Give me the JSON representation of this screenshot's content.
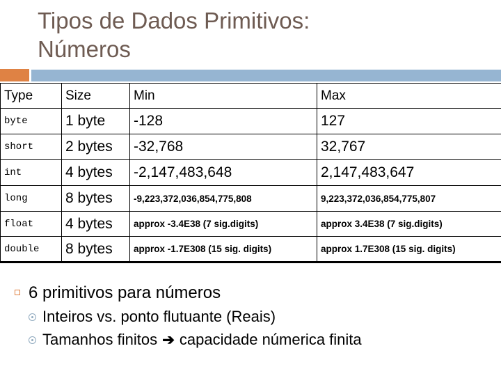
{
  "slide": {
    "title": "Tipos de Dados Primitivos:\nNúmeros",
    "title_color": "#6E5B52",
    "accent_orange": "#DF8244",
    "accent_blue": "#96B5D2"
  },
  "table": {
    "headers": [
      "Type",
      "Size",
      "Min",
      "Max"
    ],
    "rows": [
      {
        "type": "byte",
        "size": "1 byte",
        "min": "-128",
        "max": "127",
        "small": false
      },
      {
        "type": "short",
        "size": "2 bytes",
        "min": "-32,768",
        "max": "32,767",
        "small": false
      },
      {
        "type": "int",
        "size": "4 bytes",
        "min": "-2,147,483,648",
        "max": "2,147,483,647",
        "small": false
      },
      {
        "type": "long",
        "size": "8 bytes",
        "min": "-9,223,372,036,854,775,808",
        "max": "9,223,372,036,854,775,807",
        "small": true
      },
      {
        "type": "float",
        "size": "4 bytes",
        "min": "approx -3.4E38 (7 sig.digits)",
        "max": "approx 3.4E38 (7 sig.digits)",
        "small": true
      },
      {
        "type": "double",
        "size": "8 bytes",
        "min": "approx -1.7E308 (15 sig. digits)",
        "max": "approx 1.7E308 (15 sig. digits)",
        "small": true
      }
    ]
  },
  "bullets": {
    "level1": "6 primitivos para números",
    "level2_a": "Inteiros vs. ponto flutuante (Reais)",
    "level2_b_before": "Tamanhos finitos ",
    "level2_b_arrow": "➔",
    "level2_b_after": " capacidade númerica finita"
  }
}
